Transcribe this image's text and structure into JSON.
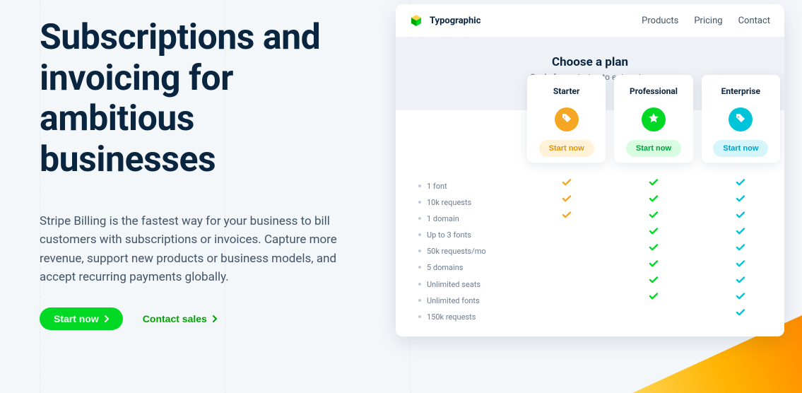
{
  "hero": {
    "title": "Subscriptions and invoicing for ambitious businesses",
    "body": "Stripe Billing is the fastest way for your business to bill customers with subscriptions or invoices. Capture more revenue, support new products or business models, and accept recurring payments globally.",
    "primary_cta": "Start now",
    "secondary_cta": "Contact sales"
  },
  "app": {
    "brand": "Typographic",
    "nav": [
      "Products",
      "Pricing",
      "Contact"
    ],
    "plan_section_title": "Choose a plan",
    "plan_section_subtitle": "Scale from startup to enterprise",
    "plans": [
      {
        "name": "Starter",
        "cta": "Start now",
        "color": "#f5a623",
        "cta_bg": "#fff2d9",
        "cta_fg": "#e49400",
        "icon": "tag"
      },
      {
        "name": "Professional",
        "cta": "Start now",
        "color": "#00d924",
        "cta_bg": "#d9fde0",
        "cta_fg": "#00a13a",
        "icon": "star"
      },
      {
        "name": "Enterprise",
        "cta": "Start now",
        "color": "#00c4d9",
        "cta_bg": "#d4f6fb",
        "cta_fg": "#00a2c7",
        "icon": "tag"
      }
    ],
    "features": [
      "1 font",
      "10k requests",
      "1 domain",
      "Up to 3 fonts",
      "50k requests/mo",
      "5 domains",
      "Unlimited seats",
      "Unlimited fonts",
      "150k requests"
    ],
    "matrix": [
      [
        true,
        true,
        true,
        false,
        false,
        false,
        false,
        false,
        false
      ],
      [
        true,
        true,
        true,
        true,
        true,
        true,
        true,
        true,
        false
      ],
      [
        true,
        true,
        true,
        true,
        true,
        true,
        true,
        true,
        true
      ]
    ]
  },
  "colors": {
    "primary_green": "#00d924",
    "link_green": "#00a600"
  }
}
